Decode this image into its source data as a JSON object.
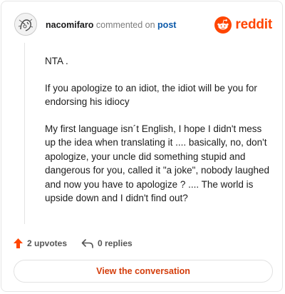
{
  "header": {
    "username": "nacomifaro",
    "action_text": "commented on",
    "post_link_text": "post",
    "brand_name": "reddit"
  },
  "comment": {
    "paragraphs": [
      "NTA .",
      "If you apologize to an idiot, the idiot will be you for endorsing his idiocy",
      "My first language isn´t English, I hope I didn't mess up the idea when translating it .... basically, no, don't apologize, your uncle did something stupid and dangerous for you, called it \"a joke\", nobody laughed and now you have to apologize ? .... The world is upside down and I didn't find out?"
    ]
  },
  "footer": {
    "upvotes_label": "2 upvotes",
    "replies_label": "0 replies",
    "cta_label": "View the conversation"
  },
  "icons": {
    "avatar": "avatar-image",
    "brand_logo": "reddit-snoo-icon",
    "upvote": "upvote-arrow-icon",
    "reply": "reply-arrow-icon"
  },
  "colors": {
    "brand": "#ff4500",
    "upvote_arrow": "#ff4500",
    "post_link": "#0a58a8",
    "cta_text": "#d43d0b",
    "muted_text": "#7c7c7c"
  }
}
